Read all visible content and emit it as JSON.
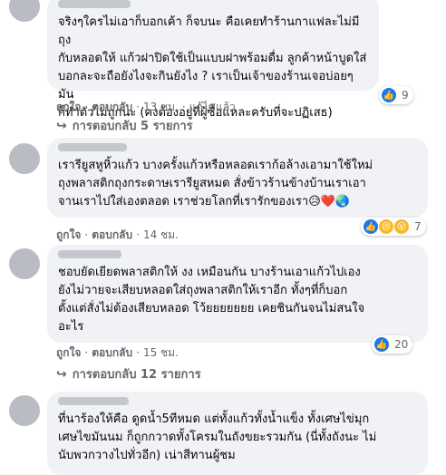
{
  "comments": [
    {
      "body": "จริงๆใครไม่เอาก็บอกเค้า ก็จบนะ คือเคยทำร้านกาแฟละไม่มีถุง\nกับหลอดให้ แก้วฝาปิดใช้เป็นแบบฝาพร้อมดื่ม ลูกค้าหน้าบูดใส่\nบอกละจะถือยังไงจะกินยังไง ? เราเป็นเจ้าของร้านเจอบ่อยๆมัน\nก็ทำตัวไม่ถูกนะ (คงต้องอยู่ที่ผู้ซื้อแหละครับที่จะปฏิเสธ)",
      "reaction_count": "9",
      "like": "ถูกใจ",
      "reply": "ตอบกลับ",
      "time": "13 ชม.",
      "edited": "แก้ไขแล้ว",
      "replies": "การตอบกลับ 5 รายการ"
    },
    {
      "body": "เรารียูสหูหิ้วแก้ว บางครั้งแก้วหรือหลอดเราก้อล้างเอามาใช้ใหม่\nถุงพลาสติกถุงกระดาษเรารียูสหมด สั่งข้าวร้านข้างบ้านเราเอา\nจานเราไปใส่เองตลอด เราช่วยโลกที่เรารักของเรา😥❤️🌏",
      "reaction_count": "7",
      "like": "ถูกใจ",
      "reply": "ตอบกลับ",
      "time": "14 ชม."
    },
    {
      "body": "ชอบยัดเยียดพลาสติกให้ งง เหมือนกัน บางร้านเอาแก้วไปเอง\nยังไม่วายจะเสียบหลอดใส่ถุงพลาสติกให้เราอีก ทั้งๆที่ก็บอก\nตั้งแต่สั่งไม่ต้องเสียบหลอด โว้ยยยยยยย เคยชินกันจนไม่สนใจ\nอะไร",
      "reaction_count": "20",
      "like": "ถูกใจ",
      "reply": "ตอบกลับ",
      "time": "15 ชม.",
      "replies": "การตอบกลับ 12 รายการ"
    },
    {
      "body": "ที่นาร้องให้คือ ดูดน้ำ5ทีหมด แต่ทั้งแก้วทั้งน้ำแข็ง ทั้งเศษไข่มุก\nเศษไขมันนม ก็ถูกกวาดทั้งโครมในถังขยะรวมกัน (นี่ทั้งถังนะ ไม่\nนับพวกวางไปทั่วอีก) เน่าสีทานผู้ชม"
    }
  ],
  "colors": {
    "like_blue": "#1877f2",
    "love_red": "#f33e58",
    "haha_yellow": "#f7b928"
  }
}
